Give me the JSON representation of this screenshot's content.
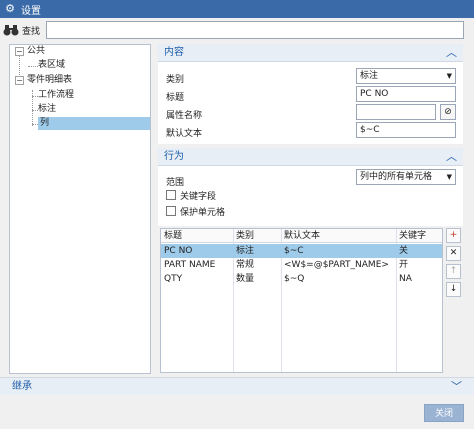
{
  "window": {
    "title": "设置"
  },
  "search": {
    "label": "查找",
    "value": ""
  },
  "tree": {
    "items": [
      {
        "label": "公共"
      },
      {
        "label": "表区域"
      },
      {
        "label": "零件明细表"
      },
      {
        "label": "工作流程"
      },
      {
        "label": "标注"
      },
      {
        "label": "列"
      }
    ]
  },
  "content": {
    "header": "内容",
    "category_label": "类别",
    "category_value": "标注",
    "title_label": "标题",
    "title_value": "PC NO",
    "attr_label": "属性名称",
    "attr_value": "",
    "default_text_label": "默认文本",
    "default_text_value": "$~C"
  },
  "behavior": {
    "header": "行为",
    "scope_label": "范围",
    "scope_value": "列中的所有单元格",
    "key_field_label": "关键字段",
    "protect_cell_label": "保护单元格"
  },
  "table": {
    "columns": [
      "标题",
      "类别",
      "默认文本",
      "关键字"
    ],
    "rows": [
      [
        "PC NO",
        "标注",
        "$~C",
        "关"
      ],
      [
        "PART NAME",
        "常规",
        "<W$=@$PART_NAME>",
        "开"
      ],
      [
        "QTY",
        "数量",
        "$~Q",
        "NA"
      ]
    ]
  },
  "inherit": {
    "header": "继承"
  },
  "footer": {
    "close_label": "关闭"
  }
}
